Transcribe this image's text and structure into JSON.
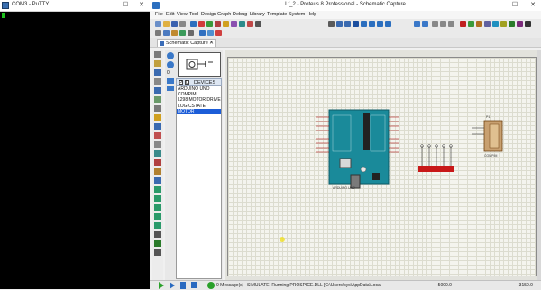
{
  "putty": {
    "title": "COM3 - PuTTY",
    "controls": {
      "minimize": "—",
      "maximize": "☐",
      "close": "✕"
    }
  },
  "proteus": {
    "title": "Lf_2 - Proteus 8 Professional - Schematic Capture",
    "controls": {
      "minimize": "—",
      "maximize": "☐",
      "close": "✕"
    },
    "menu": [
      "File",
      "Edit",
      "View",
      "Tool",
      "Design",
      "Graph",
      "Debug",
      "Library",
      "Template",
      "System",
      "Help"
    ],
    "tab": {
      "label": "Schematic Capture",
      "close": "✕"
    },
    "devices": {
      "header": "DEVICES",
      "p_button": "P",
      "l_button": "L",
      "items": [
        "ARDUINO UNO",
        "COMPIM",
        "L298 MOTOR DRIVER",
        "LOGICSTATE",
        "MOTOR"
      ],
      "selected_index": 4
    },
    "schematic": {
      "arduino_label": "ARDUINO UNO",
      "compim_label": "COMPIM",
      "p1_label": "P1",
      "arduino_color": "#1a8a9a",
      "chip_color": "#222222",
      "logic_color": "#c81818"
    },
    "status": {
      "messages": "0 Message(s)",
      "simulate": "SIMULATE: Running PROSPICE.DLL [C:\\Users\\sys\\AppData\\Local",
      "coord_x": "-5000.0",
      "coord_y": "-3150.0"
    }
  }
}
